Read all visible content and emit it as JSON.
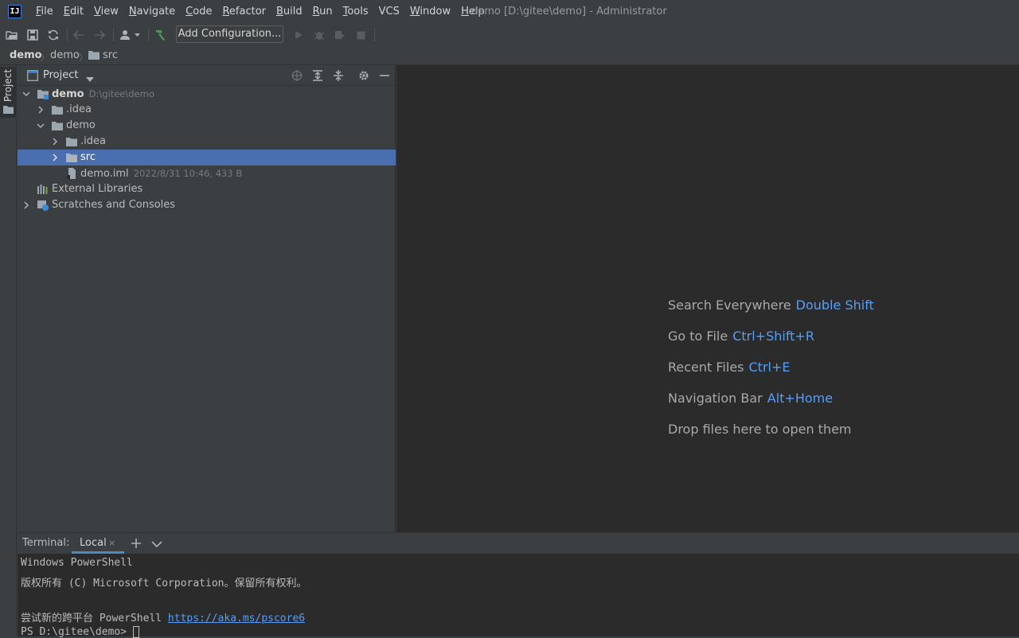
{
  "app": {
    "logo_text": "IJ"
  },
  "menu": {
    "items": [
      {
        "u": "F",
        "rest": "ile"
      },
      {
        "u": "E",
        "rest": "dit"
      },
      {
        "u": "V",
        "rest": "iew"
      },
      {
        "u": "N",
        "rest": "avigate"
      },
      {
        "u": "C",
        "rest": "ode"
      },
      {
        "u": "R",
        "rest": "efactor"
      },
      {
        "u": "B",
        "rest": "uild"
      },
      {
        "u": "R",
        "rest": "un"
      },
      {
        "u": "T",
        "rest": "ools"
      },
      {
        "u": "",
        "rest": "VCS"
      },
      {
        "u": "W",
        "rest": "indow"
      },
      {
        "u": "H",
        "rest": "elp"
      }
    ]
  },
  "window_title": "demo [D:\\gitee\\demo] - Administrator",
  "toolbar": {
    "add_configuration": "Add Configuration..."
  },
  "breadcrumb": {
    "items": [
      "demo",
      "demo",
      "src"
    ]
  },
  "left_stripe": {
    "project_tab": "Project"
  },
  "project_panel": {
    "title": "Project",
    "tree": [
      {
        "label": "demo",
        "meta": "D:\\gitee\\demo"
      },
      {
        "label": ".idea",
        "meta": ""
      },
      {
        "label": "demo",
        "meta": ""
      },
      {
        "label": ".idea",
        "meta": ""
      },
      {
        "label": "src",
        "meta": ""
      },
      {
        "label": "demo.iml",
        "meta": "2022/8/31 10:46, 433 B"
      },
      {
        "label": "External Libraries",
        "meta": ""
      },
      {
        "label": "Scratches and Consoles",
        "meta": ""
      }
    ]
  },
  "editor": {
    "hints": [
      {
        "text": "Search Everywhere",
        "key": "Double Shift"
      },
      {
        "text": "Go to File",
        "key": "Ctrl+Shift+R"
      },
      {
        "text": "Recent Files",
        "key": "Ctrl+E"
      },
      {
        "text": "Navigation Bar",
        "key": "Alt+Home"
      },
      {
        "text": "Drop files here to open them",
        "key": ""
      }
    ]
  },
  "terminal": {
    "label": "Terminal:",
    "tab": "Local",
    "tab_close": "×",
    "lines": [
      "Windows PowerShell",
      "版权所有 (C) Microsoft Corporation。保留所有权利。",
      "",
      "尝试新的跨平台 PowerShell "
    ],
    "link": "https://aka.ms/pscore6",
    "prompt": "PS D:\\gitee\\demo> "
  },
  "colors": {
    "accent": "#589df6",
    "selection": "#4b6eaf",
    "background": "#3c3f41",
    "editor_bg": "#2b2b2b"
  }
}
